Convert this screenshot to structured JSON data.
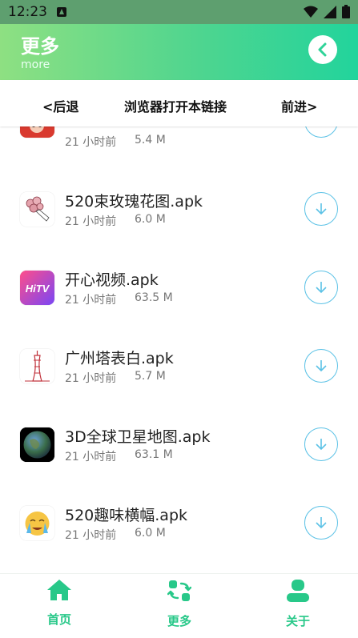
{
  "status_bar": {
    "time": "12:23"
  },
  "header": {
    "title": "更多",
    "subtitle": "more"
  },
  "browser_nav": {
    "back": "<后退",
    "open": "浏览器打开本链接",
    "forward": "前进>"
  },
  "partial_item": {
    "time": "21 小时前",
    "size": "5.4 M"
  },
  "apps": [
    {
      "name": "520束玫瑰花图.apk",
      "time": "21 小时前",
      "size": "6.0 M",
      "icon": "rose-bouquet-icon"
    },
    {
      "name": "开心视频.apk",
      "time": "21 小时前",
      "size": "63.5 M",
      "icon": "hitv-icon",
      "icon_text": "HiTV"
    },
    {
      "name": "广州塔表白.apk",
      "time": "21 小时前",
      "size": "5.7 M",
      "icon": "canton-tower-icon"
    },
    {
      "name": "3D全球卫星地图.apk",
      "time": "21 小时前",
      "size": "63.1 M",
      "icon": "globe-icon"
    },
    {
      "name": "520趣味横幅.apk",
      "time": "21 小时前",
      "size": "6.0 M",
      "icon": "crying-emoji-icon"
    }
  ],
  "tabs": [
    {
      "label": "首页",
      "icon": "home-icon"
    },
    {
      "label": "更多",
      "icon": "refresh-grid-icon"
    },
    {
      "label": "关于",
      "icon": "person-icon"
    }
  ],
  "colors": {
    "accent": "#28c889",
    "download_ring": "#5cc2e6"
  }
}
